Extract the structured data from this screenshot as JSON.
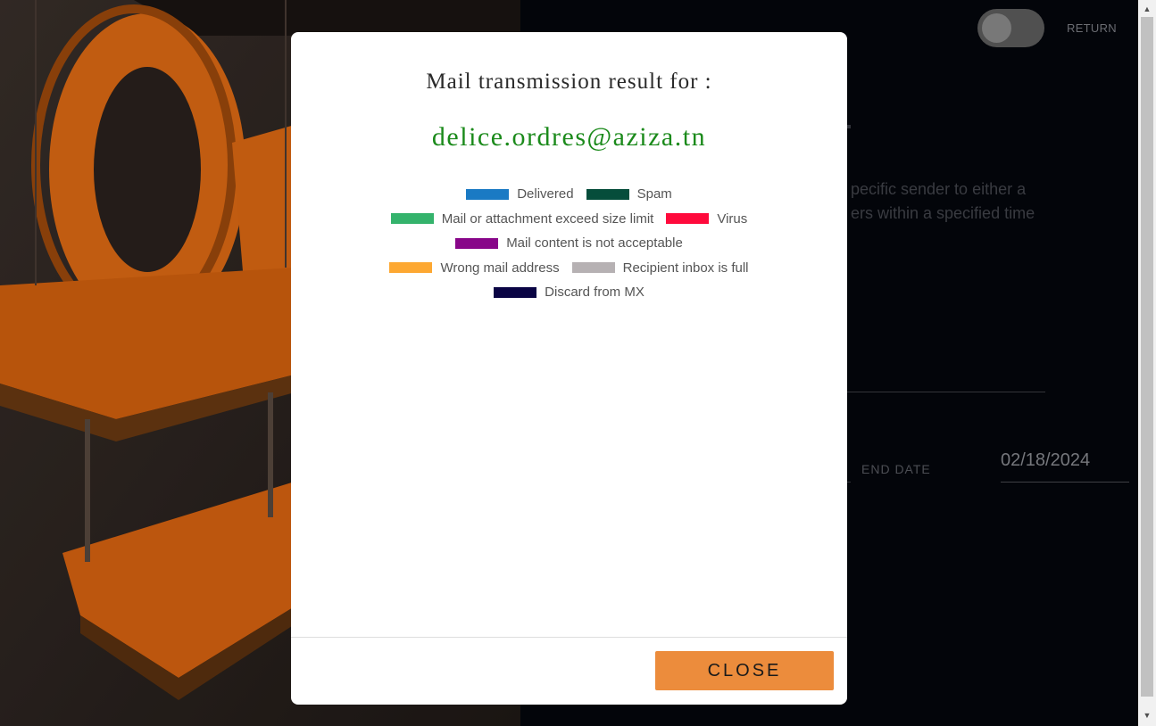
{
  "background": {
    "return_label": "RETURN",
    "description_line_1": "pecific sender to either a",
    "description_line_2": "ers within a specified time",
    "end_date_label": "END DATE",
    "end_date_value": "02/18/2024"
  },
  "modal": {
    "heading": "Mail transmission result for :",
    "email": "delice.ordres@aziza.tn",
    "legend": [
      [
        {
          "label": "Delivered",
          "color": "#1a7ac4"
        },
        {
          "label": "Spam",
          "color": "#064d3b"
        }
      ],
      [
        {
          "label": "Mail or attachment exceed size limit",
          "color": "#34b36c"
        },
        {
          "label": "Virus",
          "color": "#ff0a3c"
        }
      ],
      [
        {
          "label": "Mail content is not acceptable",
          "color": "#880689"
        }
      ],
      [
        {
          "label": "Wrong mail address",
          "color": "#fda832"
        },
        {
          "label": "Recipient inbox is full",
          "color": "#b6b1b3"
        }
      ],
      [
        {
          "label": "Discard from MX",
          "color": "#0a0444"
        }
      ]
    ],
    "close_label": "CLOSE"
  },
  "colors": {
    "email_text": "#1b8a1b",
    "close_button": "#ec8c3c",
    "sign_orange": "#e06a12"
  }
}
